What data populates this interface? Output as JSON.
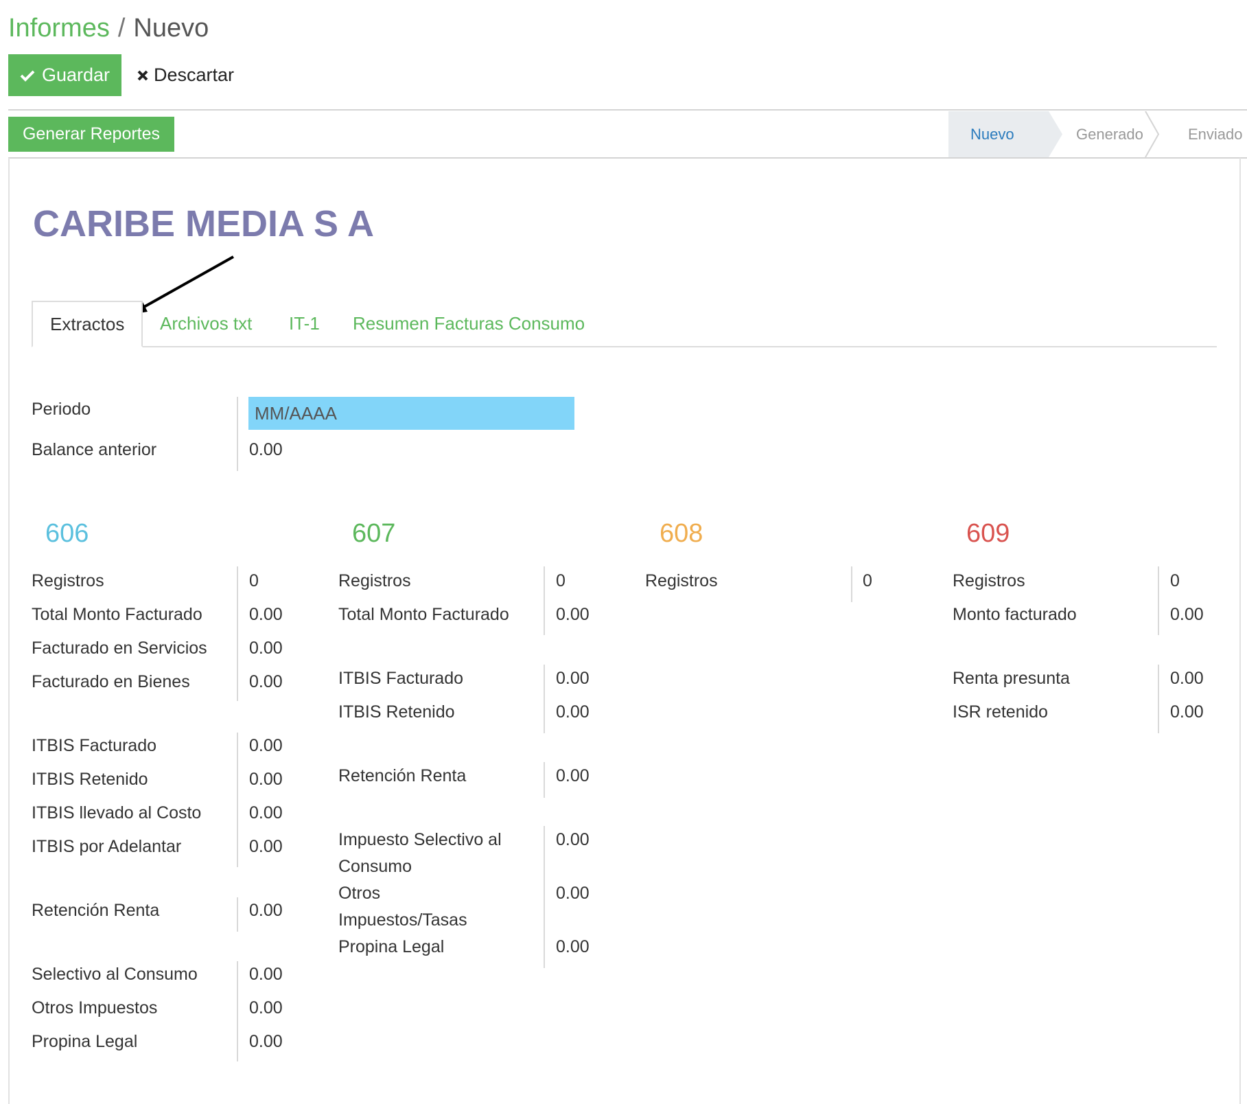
{
  "breadcrumb": {
    "parent": "Informes",
    "separator": "/",
    "current": "Nuevo"
  },
  "toolbar": {
    "save_label": "Guardar",
    "discard_label": "Descartar",
    "generate_label": "Generar Reportes"
  },
  "status": {
    "stages": [
      "Nuevo",
      "Generado",
      "Enviado"
    ],
    "active": "Nuevo"
  },
  "company": "CARIBE MEDIA S A",
  "tabs": [
    "Extractos",
    "Archivos txt",
    "IT-1",
    "Resumen Facturas Consumo"
  ],
  "period": {
    "label": "Periodo",
    "placeholder": "MM/AAAA"
  },
  "balance": {
    "label": "Balance anterior",
    "value": "0.00"
  },
  "col606": {
    "title": "606",
    "color": "#5bc0de",
    "registros_label": "Registros",
    "registros": "0",
    "total_label": "Total Monto Facturado",
    "total": "0.00",
    "servicios_label": "Facturado en Servicios",
    "servicios": "0.00",
    "bienes_label": "Facturado en Bienes",
    "bienes": "0.00",
    "itbis_fact_label": "ITBIS Facturado",
    "itbis_fact": "0.00",
    "itbis_ret_label": "ITBIS Retenido",
    "itbis_ret": "0.00",
    "itbis_costo_label": "ITBIS llevado al Costo",
    "itbis_costo": "0.00",
    "itbis_adel_label": "ITBIS por Adelantar",
    "itbis_adel": "0.00",
    "ret_renta_label": "Retención Renta",
    "ret_renta": "0.00",
    "selectivo_label": "Selectivo al Consumo",
    "selectivo": "0.00",
    "otros_label": "Otros Impuestos",
    "otros": "0.00",
    "propina_label": "Propina Legal",
    "propina": "0.00"
  },
  "col607": {
    "title": "607",
    "color": "#5cb85c",
    "registros_label": "Registros",
    "registros": "0",
    "total_label": "Total Monto Facturado",
    "total": "0.00",
    "itbis_fact_label": "ITBIS Facturado",
    "itbis_fact": "0.00",
    "itbis_ret_label": "ITBIS Retenido",
    "itbis_ret": "0.00",
    "ret_renta_label": "Retención Renta",
    "ret_renta": "0.00",
    "isc_label_1": "Impuesto Selectivo al",
    "isc_label_2": "Consumo",
    "isc": "0.00",
    "otros_label_1": "Otros",
    "otros_label_2": "Impuestos/Tasas",
    "otros": "0.00",
    "propina_label": "Propina Legal",
    "propina": "0.00"
  },
  "col608": {
    "title": "608",
    "color": "#f0ad4e",
    "registros_label": "Registros",
    "registros": "0"
  },
  "col609": {
    "title": "609",
    "color": "#d9534f",
    "registros_label": "Registros",
    "registros": "0",
    "monto_label": "Monto facturado",
    "monto": "0.00",
    "renta_label": "Renta presunta",
    "renta": "0.00",
    "isr_label": "ISR retenido",
    "isr": "0.00"
  }
}
